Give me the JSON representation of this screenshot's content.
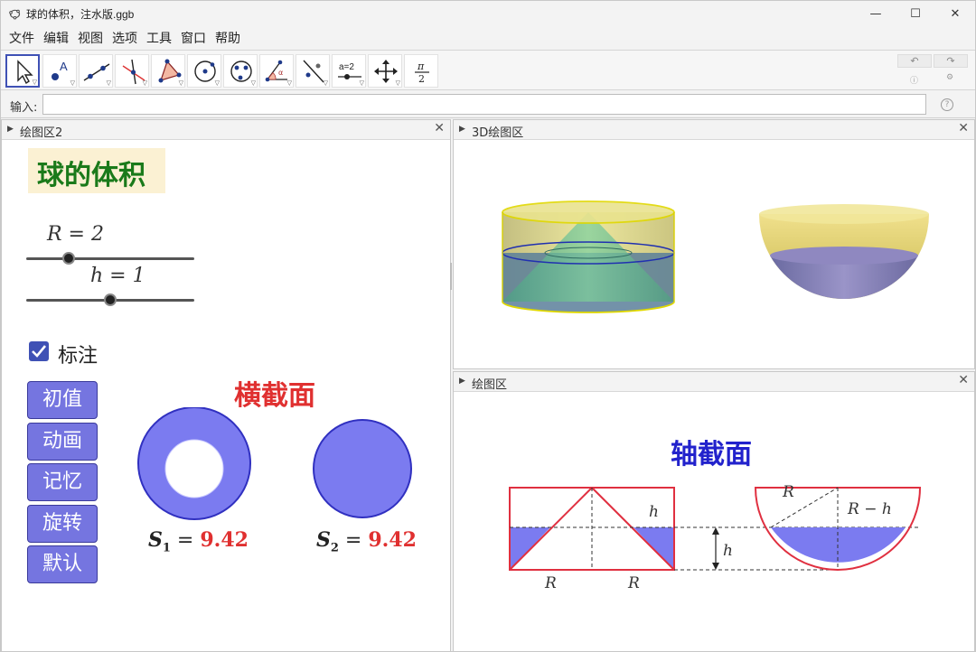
{
  "window": {
    "title": "球的体积，注水版.ggb"
  },
  "menu": [
    "文件",
    "编辑",
    "视图",
    "选项",
    "工具",
    "窗口",
    "帮助"
  ],
  "input": {
    "label": "输入:",
    "value": ""
  },
  "panels": {
    "left": {
      "title": "绘图区2"
    },
    "top_right": {
      "title": "3D绘图区"
    },
    "bottom_right": {
      "title": "绘图区"
    }
  },
  "graphics2": {
    "title": "球的体积",
    "slider_r": {
      "label": "R = 2",
      "value": 2
    },
    "slider_h": {
      "label": "h = 1",
      "value": 1
    },
    "checkbox": {
      "label": "标注",
      "checked": true
    },
    "buttons": [
      "初值",
      "动画",
      "记忆",
      "旋转",
      "默认"
    ],
    "cross_section_title": "横截面",
    "s1": {
      "label": "S",
      "sub": "1",
      "eq": " = ",
      "value": "9.42"
    },
    "s2": {
      "label": "S",
      "sub": "2",
      "eq": " = ",
      "value": "9.42"
    }
  },
  "graphics1": {
    "title": "轴截面",
    "labels": {
      "h_top": "h",
      "h_mid": "h",
      "R_left": "R",
      "R_right": "R",
      "R_hemi": "R",
      "R_minus_h": "R − h"
    }
  },
  "colors": {
    "accent": "#3f51b5",
    "button": "#7575e0",
    "fill_blue": "#7b7bf0",
    "red": "#e03030",
    "title_green": "#1a7a1a",
    "title_blue": "#2222cc"
  }
}
